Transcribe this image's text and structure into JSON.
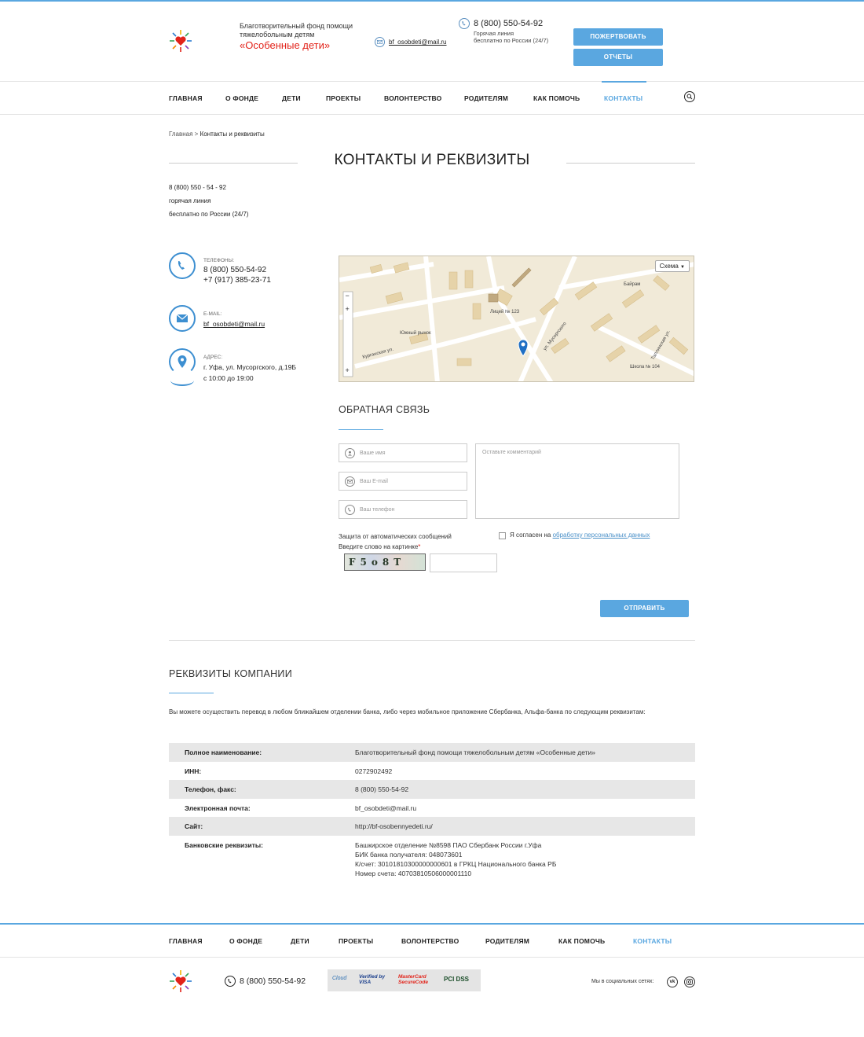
{
  "header": {
    "fund_line1": "Благотворительный фонд помощи",
    "fund_line2": "тяжелобольным детям",
    "fund_name": "«Особенные дети»",
    "email": "bf_osobdeti@mail.ru",
    "phone": "8 (800) 550-54-92",
    "hotline": "Горячая линия",
    "free_russia": "бесплатно по России (24/7)",
    "donate_label": "ПОЖЕРТВОВАТЬ",
    "reports_label": "ОТЧЕТЫ"
  },
  "nav": {
    "items": [
      "ГЛАВНАЯ",
      "О ФОНДЕ",
      "ДЕТИ",
      "ПРОЕКТЫ",
      "ВОЛОНТЕРСТВО",
      "РОДИТЕЛЯМ",
      "КАК ПОМОЧЬ",
      "КОНТАКТЫ"
    ],
    "active": "КОНТАКТЫ"
  },
  "breadcrumb": {
    "home": "Главная",
    "sep": " > ",
    "current": "Контакты и реквизиты"
  },
  "page_title": "КОНТАКТЫ И РЕКВИЗИТЫ",
  "intro": {
    "phone": "8 (800) 550 - 54 - 92",
    "hotline": "горячая линия",
    "free": "бесплатно по России (24/7)"
  },
  "contacts": {
    "phones_label": "ТЕЛЕФОНЫ:",
    "phone1": "8 (800) 550-54-92",
    "phone2": "+7 (917) 385-23-71",
    "email_label": "E-MAIL:",
    "email": "bf_osobdeti@mail.ru",
    "address_label": "АДРЕС:",
    "address": "г. Уфа, ул. Мусоргского, д.19Б",
    "hours": "с 10:00 до 19:00"
  },
  "map": {
    "schema_label": "Схема",
    "labels": {
      "lyceum": "Лицей № 123",
      "market": "Южный рынок",
      "musorgsky": "ул. Мусоргского",
      "kurgan": "Курганская ул.",
      "school": "Школа № 104",
      "bairam": "Байрам",
      "talinskaya": "Таллинская ул."
    }
  },
  "feedback": {
    "title": "ОБРАТНАЯ СВЯЗЬ",
    "name_ph": "Ваше имя",
    "email_ph": "Ваш E-mail",
    "phone_ph": "Ваш телефон",
    "comment_ph": "Оставьте комментарий",
    "captcha_line1": "Защита от автоматических сообщений",
    "captcha_line2": "Введите слово на картинке",
    "captcha_required": "*",
    "captcha_text": "F5o8T",
    "agree_prefix": "Я согласен на ",
    "agree_link": "обработку персональных данных",
    "submit_label": "ОТПРАВИТЬ"
  },
  "requisites": {
    "title": "РЕКВИЗИТЫ КОМПАНИИ",
    "intro": "Вы можете осуществить перевод в любом ближайшем отделении банка, либо через мобильное приложение Сбербанка, Альфа-банка по следующим реквизитам:",
    "rows": [
      {
        "k": "Полное наименование:",
        "v": "Благотворительный фонд помощи тяжелобольным детям «Особенные дети»"
      },
      {
        "k": "ИНН:",
        "v": "0272902492"
      },
      {
        "k": "Телефон, факс:",
        "v": "8 (800) 550-54-92"
      },
      {
        "k": "Электронная почта:",
        "v": "bf_osobdeti@mail.ru"
      },
      {
        "k": "Сайт:",
        "v": "http://bf-osobennyedeti.ru/"
      },
      {
        "k": "Банковские реквизиты:",
        "v": "Башкирское отделение №8598 ПАО Сбербанк России г.Уфа"
      }
    ],
    "bank_lines": [
      "БИК банка получателя: 048073601",
      "К/счет: 30101810300000000601 в ГРКЦ Национального банка РБ",
      "Номер счета: 40703810506000001110"
    ]
  },
  "footer": {
    "nav": [
      "ГЛАВНАЯ",
      "О ФОНДЕ",
      "ДЕТИ",
      "ПРОЕКТЫ",
      "ВОЛОНТЕРСТВО",
      "РОДИТЕЛЯМ",
      "КАК ПОМОЧЬ",
      "КОНТАКТЫ"
    ],
    "phone": "8 (800) 550-54-92",
    "social_label": "Мы в социальных сетях:",
    "payments": [
      "Cloud",
      "Verified by VISA",
      "MasterCard SecureCode",
      "PCI DSS"
    ],
    "vk": "vk"
  },
  "colors": {
    "accent": "#5aa7e0",
    "brand_red": "#e2231a",
    "nav_active": "#5aa7e0"
  }
}
